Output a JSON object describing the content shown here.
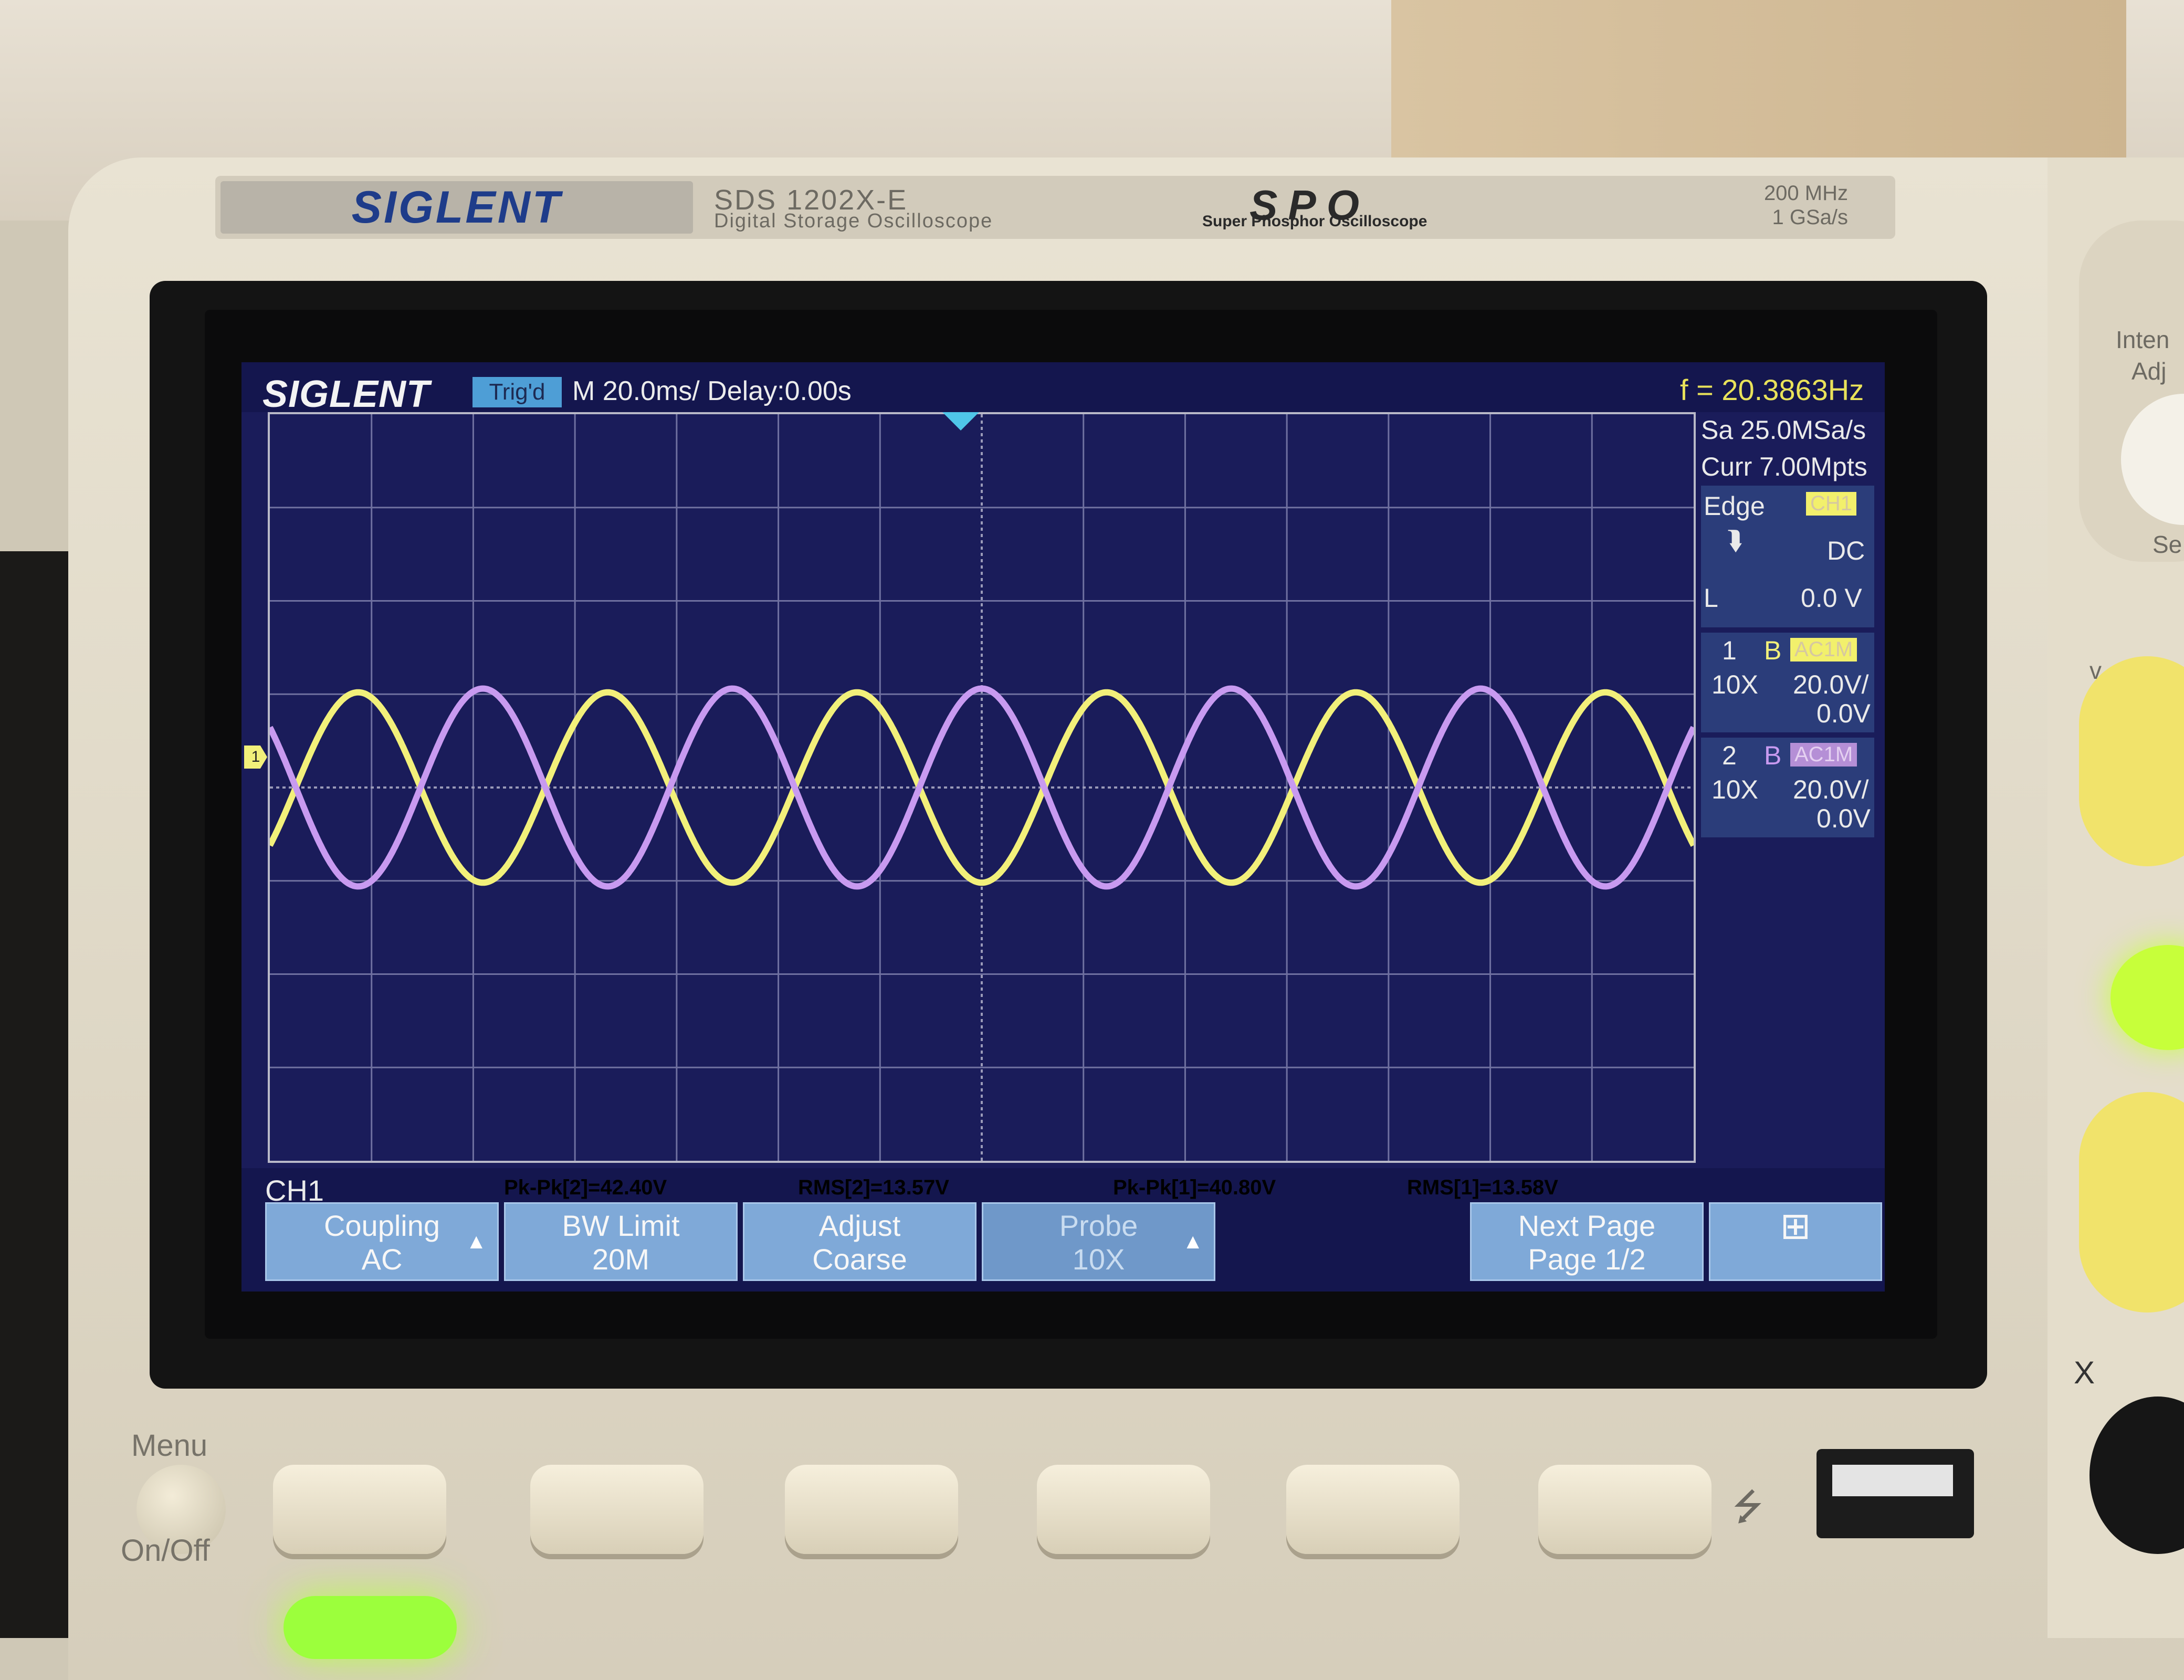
{
  "device": {
    "brand": "SIGLENT",
    "model": "SDS 1202X-E",
    "model_subtitle": "Digital Storage Oscilloscope",
    "spo_logo": "SPO",
    "spo_subtitle": "Super Phosphor Oscilloscope",
    "bandwidth": "200 MHz",
    "sample_rate_spec": "1 GSa/s",
    "panel_labels": {
      "intensity": "Inten",
      "adjust": "Adj",
      "menu": "Menu",
      "onoff": "On/Off",
      "v": "v",
      "x": "X",
      "se": "Se"
    }
  },
  "screen": {
    "brand": "SIGLENT",
    "trigger_state": "Trig'd",
    "timebase": "M 20.0ms/ Delay:0.00s",
    "frequency": "f = 20.3863Hz",
    "sample_rate": "Sa 25.0MSa/s",
    "memory_depth": "Curr 7.00Mpts",
    "trigger": {
      "type": "Edge",
      "source": "CH1",
      "coupling": "DC",
      "level_label": "L",
      "level": "0.0 V"
    },
    "channels": [
      {
        "num": "1",
        "bw_flag": "B",
        "coupling": "AC1M",
        "probe": "10X",
        "scale": "20.0V/",
        "offset": "0.0V",
        "color": "#f2f07a"
      },
      {
        "num": "2",
        "bw_flag": "B",
        "coupling": "AC1M",
        "probe": "10X",
        "scale": "20.0V/",
        "offset": "0.0V",
        "color": "#c89af0"
      }
    ],
    "channel_marker": "1",
    "active_menu": "CH1",
    "measurements": [
      {
        "label": "Pk-Pk[2]=42.40V",
        "color": "#d9a7f5"
      },
      {
        "label": "RMS[2]=13.57V",
        "color": "#d9a7f5"
      },
      {
        "label": "Pk-Pk[1]=40.80V",
        "color": "#f1ee8a"
      },
      {
        "label": "RMS[1]=13.58V",
        "color": "#f1ee8a"
      }
    ],
    "softkeys": [
      {
        "title": "Coupling",
        "value": "AC"
      },
      {
        "title": "BW Limit",
        "value": "20M"
      },
      {
        "title": "Adjust",
        "value": "Coarse"
      },
      {
        "title": "Probe",
        "value": "10X"
      },
      {
        "title": "Next Page",
        "value": "Page 1/2"
      }
    ],
    "network_icon": "network-icon"
  },
  "chart_data": {
    "type": "line",
    "title": "",
    "xlabel": "",
    "ylabel": "",
    "xlim": [
      -140,
      140
    ],
    "ylim": [
      -80,
      80
    ],
    "grid": true,
    "x_divisions": 14,
    "y_divisions": 8,
    "series": [
      {
        "name": "1",
        "color": "#f2f07a",
        "amplitude_v": 20.4,
        "frequency_hz": 20.3863,
        "phase_deg": 180
      },
      {
        "name": "2",
        "color": "#c89af0",
        "amplitude_v": 21.2,
        "frequency_hz": 20.3863,
        "phase_deg": 0
      }
    ]
  }
}
